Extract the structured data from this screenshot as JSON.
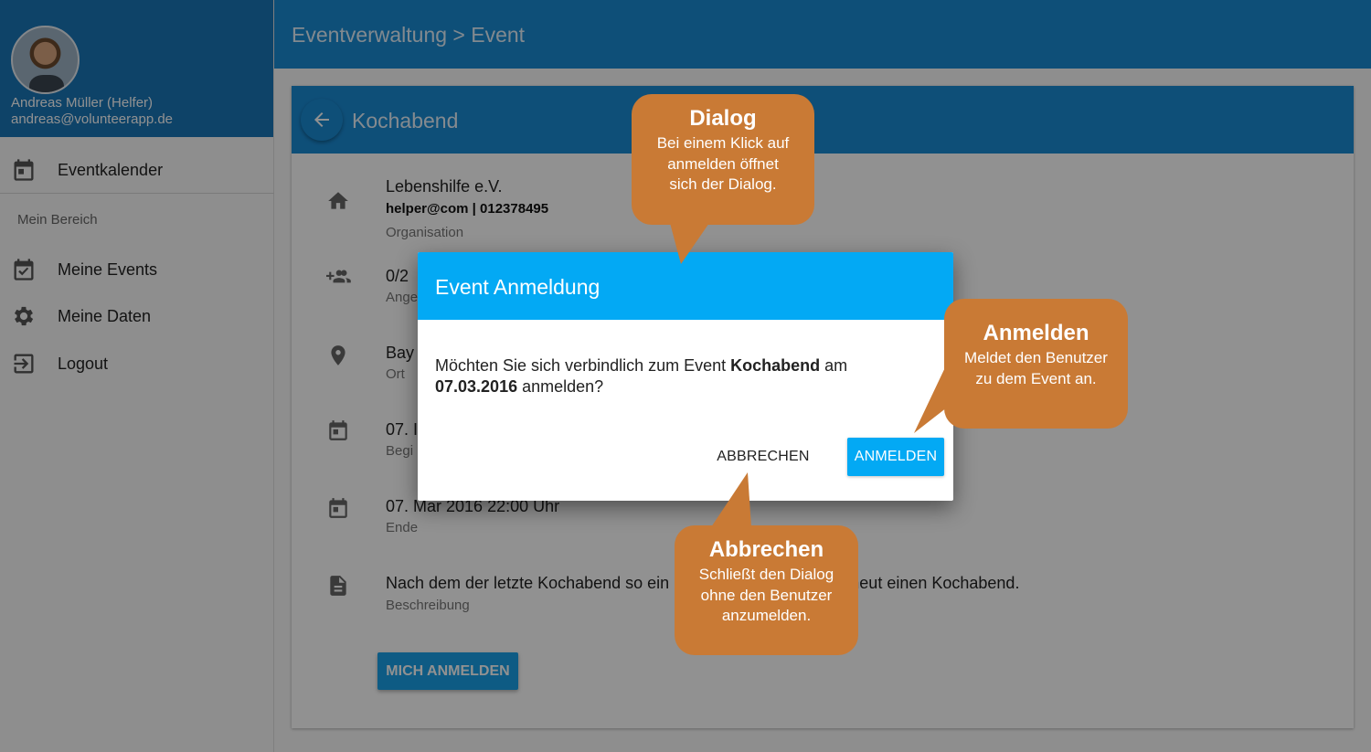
{
  "user": {
    "name": "Andreas Müller (Helfer)",
    "email": "andreas@volunteerapp.de"
  },
  "nav": {
    "eventkalender": "Eventkalender",
    "section": "Mein Bereich",
    "meine_events": "Meine Events",
    "meine_daten": "Meine Daten",
    "logout": "Logout"
  },
  "topbar": {
    "breadcrumb": "Eventverwaltung > Event"
  },
  "event": {
    "title": "Kochabend",
    "organisation": {
      "name": "Lebenshilfe e.V.",
      "contact": "helper@com | 012378495",
      "label": "Organisation"
    },
    "participants": {
      "value": "0/2",
      "label": "Ange"
    },
    "location": {
      "value": "Bay",
      "label": "Ort"
    },
    "start": {
      "value": "07. I",
      "label": "Begi"
    },
    "end": {
      "value": "07. Mar 2016 22:00 Uhr",
      "label": "Ende"
    },
    "description": {
      "value": "Nach dem der letzte Kochabend so ein Erfolg war, planen wir erneut einen Kochabend.",
      "label": "Beschreibung"
    },
    "register_button": "MICH ANMELDEN"
  },
  "dialog": {
    "title": "Event Anmeldung",
    "text_1": "Möchten Sie sich verbindlich zum Event ",
    "text_event": "Kochabend",
    "text_2": " am",
    "text_date": "07.03.2016",
    "text_3": " anmelden?",
    "cancel": "ABBRECHEN",
    "confirm": "ANMELDEN"
  },
  "callouts": {
    "dialog": {
      "title": "Dialog",
      "text": "Bei einem Klick auf anmelden öffnet sich der Dialog."
    },
    "anmelden": {
      "title": "Anmelden",
      "text": "Meldet den Benutzer zu dem Event an."
    },
    "abbrechen": {
      "title": "Abbrechen",
      "text": "Schließt den Dialog ohne den Benutzer anzumelden."
    }
  },
  "colors": {
    "primary": "#1a8bd4",
    "dialog_header": "#03a9f4",
    "callout": "#c97a35"
  }
}
